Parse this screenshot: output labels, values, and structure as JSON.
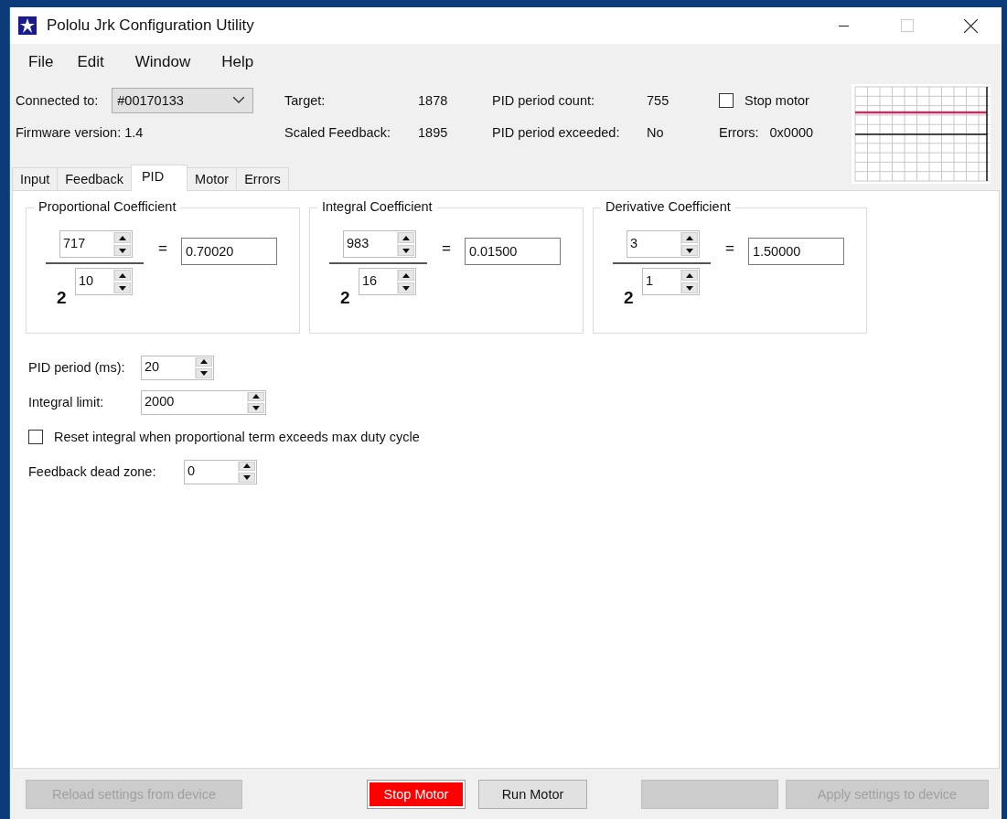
{
  "window": {
    "title": "Pololu Jrk Configuration Utility"
  },
  "menu": [
    "File",
    "Edit",
    "Window",
    "Help"
  ],
  "connection": {
    "label": "Connected to:",
    "device": "#00170133",
    "firmware": "Firmware version: 1.4"
  },
  "readout_groups": [
    [
      {
        "label": "Target:",
        "value": "1878"
      },
      {
        "label": "Scaled Feedback:",
        "value": "1895"
      }
    ],
    [
      {
        "label": "PID period count:",
        "value": "755"
      },
      {
        "label": "PID period exceeded:",
        "value": "No"
      }
    ]
  ],
  "stop_motor": {
    "label": "Stop motor",
    "checked": false
  },
  "errors": {
    "label": "Errors:",
    "value": "0x0000"
  },
  "tabs": [
    {
      "label": "Input",
      "selected": false
    },
    {
      "label": "Feedback",
      "selected": false
    },
    {
      "label": "PID",
      "selected": true
    },
    {
      "label": "Motor",
      "selected": false
    },
    {
      "label": "Errors",
      "selected": false
    }
  ],
  "coefficients": [
    {
      "title": "Proportional Coefficient",
      "numerator": "717",
      "base": "2",
      "exponent": "10",
      "equals": "=",
      "result": "0.70020"
    },
    {
      "title": "Integral Coefficient",
      "numerator": "983",
      "base": "2",
      "exponent": "16",
      "equals": "=",
      "result": "0.01500"
    },
    {
      "title": "Derivative Coefficient",
      "numerator": "3",
      "base": "2",
      "exponent": "1",
      "equals": "=",
      "result": "1.50000"
    }
  ],
  "settings": [
    {
      "kind": "spinner",
      "label": "PID period (ms):",
      "value": "20"
    },
    {
      "kind": "wide_spinner",
      "label": "Integral limit:",
      "value": "2000"
    },
    {
      "kind": "checkbox",
      "label": "Reset integral when proportional term exceeds max duty cycle",
      "checked": false
    },
    {
      "kind": "spinner",
      "label": "Feedback dead zone:",
      "value": "0"
    }
  ],
  "buttons": [
    {
      "kind": "normal",
      "label": "Reload settings from device",
      "disabled": true
    },
    {
      "kind": "danger",
      "label": "Stop Motor",
      "disabled": false
    },
    {
      "kind": "normal",
      "label": "Run Motor",
      "disabled": false
    },
    {
      "kind": "blank",
      "disabled": true
    },
    {
      "kind": "normal",
      "label": "Apply settings to device",
      "disabled": true
    }
  ]
}
